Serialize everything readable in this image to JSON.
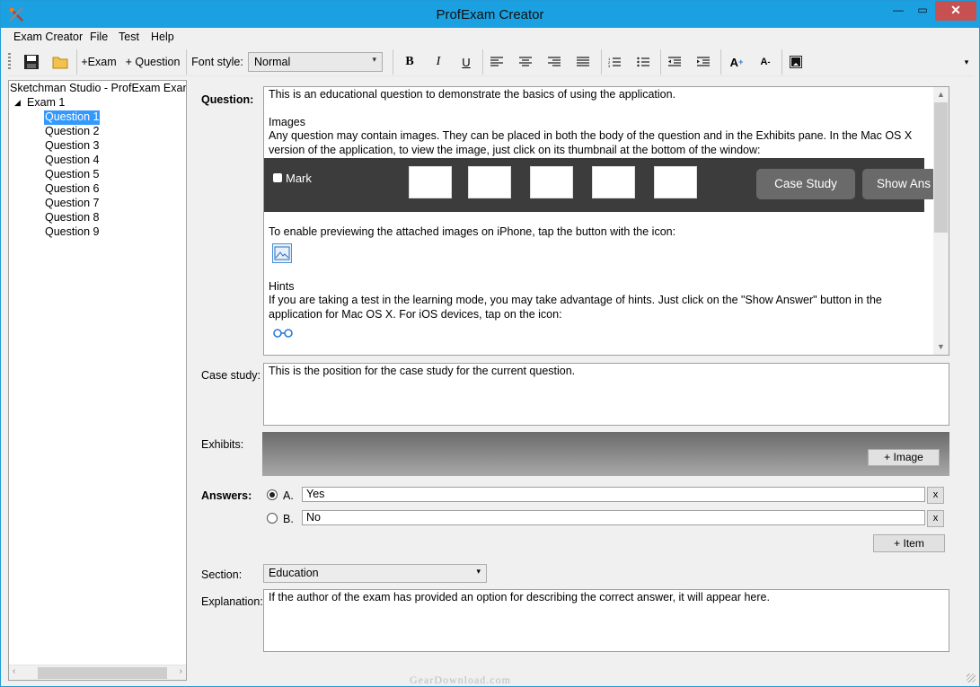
{
  "window": {
    "title": "ProfExam Creator",
    "min_glyph": "—",
    "max_glyph": "▭",
    "close_glyph": "✕"
  },
  "menu": [
    "Exam Creator",
    "File",
    "Test",
    "Help"
  ],
  "toolbar": {
    "add_exam": "+Exam",
    "add_question": "+ Question",
    "font_style_label": "Font style:",
    "font_style_value": "Normal",
    "bold": "B",
    "italic": "I",
    "underline": "U",
    "grow_font": "A",
    "shrink_font": "A"
  },
  "tree": {
    "root": "Sketchman Studio - ProfExam Examp",
    "exam": "Exam 1",
    "questions": [
      "Question 1",
      "Question 2",
      "Question 3",
      "Question 4",
      "Question 5",
      "Question 6",
      "Question 7",
      "Question 8",
      "Question 9"
    ],
    "selected": "Question 1"
  },
  "question": {
    "label": "Question:",
    "intro": "This is an educational question to demonstrate the basics of using the application.",
    "images_heading": "Images",
    "images_text": "Any question may contain images. They can be placed in both the body of the question and in the Exhibits pane. In the Mac OS X version of the application, to view the image, just click on its thumbnail at the bottom of the window:",
    "strip": {
      "mark": "Mark",
      "case_study_btn": "Case Study",
      "show_answer_btn": "Show Ans"
    },
    "preview_text": "To enable previewing the attached images on iPhone, tap the button with the icon:",
    "hints_heading": "Hints",
    "hints_text": "If you are taking a test in the learning mode, you may take advantage of hints. Just click on the \"Show Answer\" button in the application for Mac OS X. For iOS devices, tap on the icon:"
  },
  "case_study": {
    "label": "Case study:",
    "text": "This is the position for the case study for the current question."
  },
  "exhibits": {
    "label": "Exhibits:",
    "add_image": "+ Image"
  },
  "answers": {
    "label": "Answers:",
    "items": [
      {
        "letter": "A.",
        "text": "Yes",
        "selected": true,
        "remove": "x"
      },
      {
        "letter": "B.",
        "text": "No",
        "selected": false,
        "remove": "x"
      }
    ],
    "add_item": "+ Item"
  },
  "section": {
    "label": "Section:",
    "value": "Education"
  },
  "explanation": {
    "label": "Explanation:",
    "text": "If the author of the exam has provided an option for describing the correct answer, it will appear here."
  },
  "watermark": "GearDownload.com"
}
